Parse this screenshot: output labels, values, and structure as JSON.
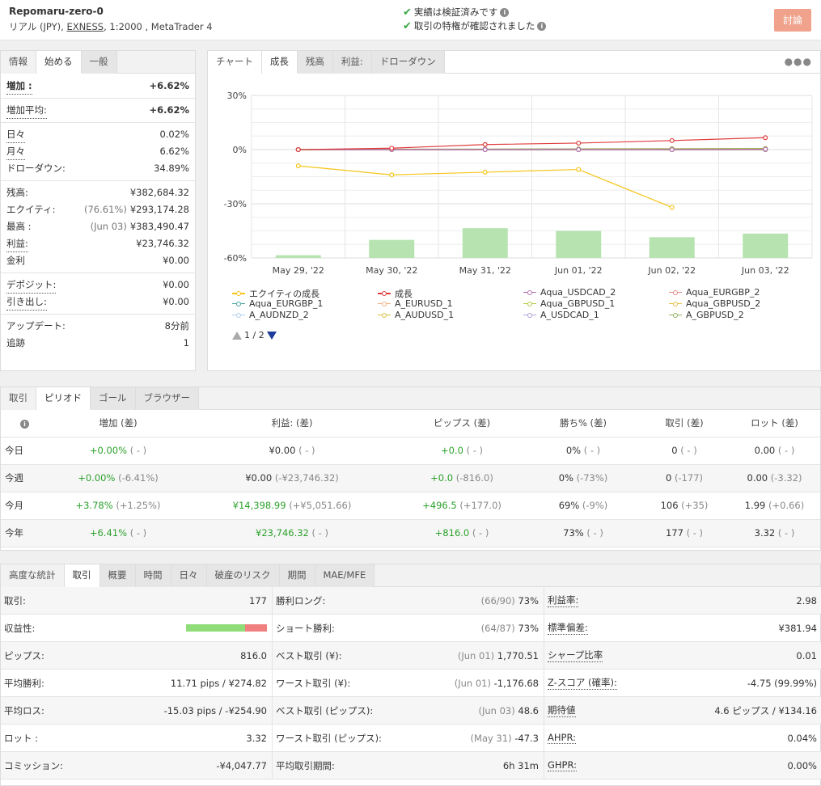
{
  "header": {
    "account_name": "Repomaru-zero-0",
    "account_type": "リアル (JPY), ",
    "broker": "EXNESS",
    "account_rest": ", 1:2000 , MetaTrader 4",
    "verified_1": "実績は検証済みです",
    "verified_2": "取引の特権が確認されました",
    "discuss_label": "討論"
  },
  "stats_tabs": [
    "情報",
    "始める",
    "一般"
  ],
  "stats": {
    "gain_label": "増加 :",
    "gain_value": "+6.62%",
    "abs_gain_label": "増加平均:",
    "abs_gain_value": "+6.62%",
    "daily_label": "日々",
    "daily_value": "0.02%",
    "monthly_label": "月々",
    "monthly_value": "6.62%",
    "drawdown_label": "ドローダウン:",
    "drawdown_value": "34.89%",
    "balance_label": "残高:",
    "balance_value": "¥382,684.32",
    "equity_label": "エクイティ:",
    "equity_sub": "(76.61%)",
    "equity_value": "¥293,174.28",
    "highest_label": "最高 :",
    "highest_sub": "(Jun 03)",
    "highest_value": "¥383,490.47",
    "profit_label": "利益:",
    "profit_value": "¥23,746.32",
    "interest_label": "金利",
    "interest_value": "¥0.00",
    "deposits_label": "デポジット:",
    "deposits_value": "¥0.00",
    "withdrawals_label": "引き出し:",
    "withdrawals_value": "¥0.00",
    "updated_label": "アップデート:",
    "updated_value": "8分前",
    "tracking_label": "追跡",
    "tracking_value": "1"
  },
  "chart_tabs": [
    "チャート",
    "成長",
    "残高",
    "利益:",
    "ドローダウン"
  ],
  "chart_data": {
    "type": "bar",
    "categories": [
      "May 29, '22",
      "May 30, '22",
      "May 31, '22",
      "Jun 01, '22",
      "Jun 02, '22",
      "Jun 03, '22"
    ],
    "ylim": [
      -60,
      30
    ],
    "yticks": [
      "30%",
      "0%",
      "-30%",
      "-60%"
    ],
    "ytick_values": [
      30,
      0,
      -30,
      -60
    ],
    "bars": [
      1.5,
      10,
      16.5,
      15,
      11.5,
      13.5
    ],
    "series": [
      {
        "name": "エクイティの成長",
        "color": "#f5c518",
        "marker": "circle",
        "values": [
          -9,
          -14,
          -12.5,
          -11,
          -32,
          null
        ]
      },
      {
        "name": "成長",
        "color": "#e03c3c",
        "marker": "diamond",
        "values": [
          0,
          0.8,
          2.8,
          3.6,
          5,
          6.6
        ]
      },
      {
        "name": "Aqua_USDCAD_2",
        "color": "#b070b0",
        "marker": "square",
        "values": [
          0,
          0,
          0,
          0,
          0,
          0.2
        ]
      },
      {
        "name": "Aqua_EURGBP_2",
        "color": "#e88888",
        "marker": "triangle",
        "values": [
          0,
          0,
          0,
          0,
          0,
          0.1
        ]
      },
      {
        "name": "Aqua_EURGBP_1",
        "color": "#4aa3a3",
        "marker": "triangle-down",
        "values": [
          0,
          0,
          0,
          0,
          0,
          0
        ]
      },
      {
        "name": "A_EURUSD_1",
        "color": "#f0b080",
        "marker": "circle",
        "values": [
          0,
          0,
          0,
          0,
          0,
          0
        ]
      },
      {
        "name": "Aqua_GBPUSD_1",
        "color": "#b8c840",
        "marker": "diamond",
        "values": [
          0,
          0.1,
          0.1,
          0.2,
          0.3,
          0.4
        ]
      },
      {
        "name": "Aqua_GBPUSD_2",
        "color": "#e8c040",
        "marker": "square",
        "values": [
          0,
          0,
          0,
          0,
          0,
          0
        ]
      },
      {
        "name": "A_AUDNZD_2",
        "color": "#b0d0f0",
        "marker": "triangle",
        "values": [
          0,
          0,
          0,
          0,
          0,
          0
        ]
      },
      {
        "name": "A_AUDUSD_1",
        "color": "#d8c040",
        "marker": "triangle-down",
        "values": [
          0,
          0,
          0,
          0,
          0,
          0
        ]
      },
      {
        "name": "A_USDCAD_1",
        "color": "#b0a0d8",
        "marker": "circle",
        "values": [
          0,
          0,
          0,
          0,
          0,
          0
        ]
      },
      {
        "name": "A_GBPUSD_2",
        "color": "#90b060",
        "marker": "diamond",
        "values": [
          0,
          0.2,
          0.3,
          0.4,
          0.5,
          0.6
        ]
      }
    ],
    "bar_color": "#b6e3b0",
    "grid": true,
    "legend": "bottom",
    "page": "1 / 2"
  },
  "period_tabs": [
    "取引",
    "ピリオド",
    "ゴール",
    "ブラウザー"
  ],
  "period_table": {
    "headers": [
      "増加 (差)",
      "利益: (差)",
      "ピップス (差)",
      "勝ち% (差)",
      "取引 (差)",
      "ロット (差)"
    ],
    "rows": [
      {
        "label": "今日",
        "gain": "+0.00%",
        "gain_d": "( - )",
        "profit": "¥0.00",
        "profit_d": "( - )",
        "pips": "+0.0",
        "pips_d": "( - )",
        "win": "0%",
        "win_d": "( - )",
        "trades": "0",
        "trades_d": "( - )",
        "lots": "0.00",
        "lots_d": "( - )"
      },
      {
        "label": "今週",
        "gain": "+0.00%",
        "gain_d": "(-6.41%)",
        "profit": "¥0.00",
        "profit_d": "(-¥23,746.32)",
        "pips": "+0.0",
        "pips_d": "(-816.0)",
        "win": "0%",
        "win_d": "(-73%)",
        "trades": "0",
        "trades_d": "(-177)",
        "lots": "0.00",
        "lots_d": "(-3.32)"
      },
      {
        "label": "今月",
        "gain": "+3.78%",
        "gain_d": "(+1.25%)",
        "profit": "¥14,398.99",
        "profit_d": "(+¥5,051.66)",
        "pips": "+496.5",
        "pips_d": "(+177.0)",
        "win": "69%",
        "win_d": "(-9%)",
        "trades": "106",
        "trades_d": "(+35)",
        "lots": "1.99",
        "lots_d": "(+0.66)"
      },
      {
        "label": "今年",
        "gain": "+6.41%",
        "gain_d": "( - )",
        "profit": "¥23,746.32",
        "profit_d": "( - )",
        "pips": "+816.0",
        "pips_d": "( - )",
        "win": "73%",
        "win_d": "( - )",
        "trades": "177",
        "trades_d": "( - )",
        "lots": "3.32",
        "lots_d": "( - )"
      }
    ]
  },
  "adv_tabs": [
    "高度な統計",
    "取引",
    "概要",
    "時間",
    "日々",
    "破産のリスク",
    "期間",
    "MAE/MFE"
  ],
  "adv": {
    "col1": [
      {
        "k": "取引:",
        "v": "177"
      },
      {
        "k": "収益性:",
        "v": ""
      },
      {
        "k": "ピップス:",
        "v": "816.0"
      },
      {
        "k": "平均勝利:",
        "v": "11.71 pips / ¥274.82"
      },
      {
        "k": "平均ロス:",
        "v": "-15.03 pips / -¥254.90"
      },
      {
        "k": "ロット :",
        "v": "3.32"
      },
      {
        "k": "コミッション:",
        "v": "-¥4,047.77"
      }
    ],
    "profitability": 0.73,
    "col2": [
      {
        "k": "勝利ロング:",
        "s": "(66/90)",
        "v": "73%"
      },
      {
        "k": "ショート勝利:",
        "s": "(64/87)",
        "v": "73%"
      },
      {
        "k": "ベスト取引 (¥):",
        "s": "(Jun 01)",
        "v": "1,770.51"
      },
      {
        "k": "ワースト取引 (¥):",
        "s": "(Jun 01)",
        "v": "-1,176.68"
      },
      {
        "k": "ベスト取引 (ピップス):",
        "s": "(Jun 03)",
        "v": "48.6"
      },
      {
        "k": "ワースト取引 (ピップス):",
        "s": "(May 31)",
        "v": "-47.3"
      },
      {
        "k": "平均取引期間:",
        "s": "",
        "v": "6h 31m"
      }
    ],
    "col3": [
      {
        "k": "利益率:",
        "v": "2.98"
      },
      {
        "k": "標準偏差:",
        "v": "¥381.94"
      },
      {
        "k": "シャープ比率",
        "v": "0.01"
      },
      {
        "k": "Z-スコア (確率):",
        "v": "-4.75 (99.99%)"
      },
      {
        "k": "期待値",
        "v": "4.6 ピップス / ¥134.16"
      },
      {
        "k": "AHPR:",
        "v": "0.04%"
      },
      {
        "k": "GHPR:",
        "v": "0.00%"
      }
    ]
  }
}
